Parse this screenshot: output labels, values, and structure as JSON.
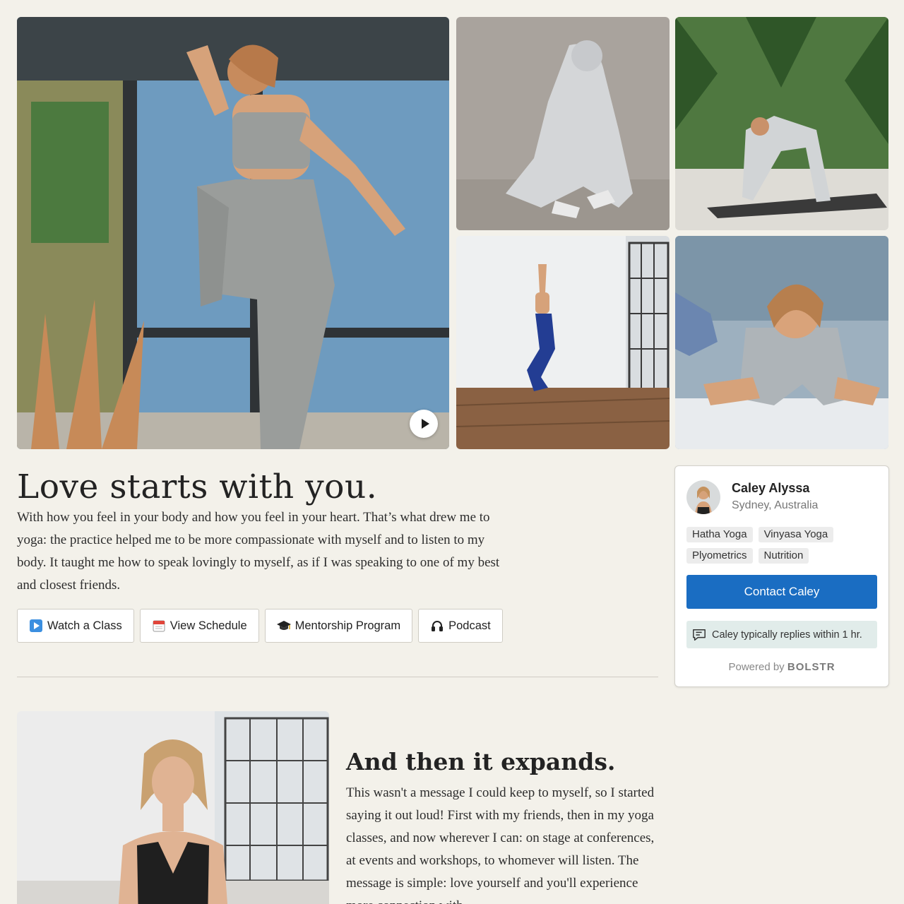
{
  "intro": {
    "headline": "Love starts with you.",
    "body": "With how you feel in your body and how you feel in your heart. That’s what drew me to yoga: the practice helped me to be more compassionate with myself and to listen to my body. It taught me how to speak lovingly to myself, as if I was speaking to one of my best and closest friends."
  },
  "actions": [
    {
      "label": "Watch a Class",
      "icon": "play-emoji-icon"
    },
    {
      "label": "View Schedule",
      "icon": "calendar-emoji-icon"
    },
    {
      "label": "Mentorship Program",
      "icon": "graduation-cap-icon"
    },
    {
      "label": "Podcast",
      "icon": "headphones-icon"
    }
  ],
  "profile": {
    "name": "Caley Alyssa",
    "location": "Sydney, Australia",
    "tags": [
      "Hatha Yoga",
      "Vinyasa Yoga",
      "Plyometrics",
      "Nutrition"
    ],
    "contact_label": "Contact Caley",
    "reply_text": "Caley typically replies within 1 hr.",
    "powered_by": "Powered by",
    "brand": "BOLSTR"
  },
  "section2": {
    "heading": "And then it expands.",
    "body": "This wasn't a message I could keep to myself, so I started saying it out loud! First with my friends, then in my yoga classes, and now wherever I can: on stage at conferences, at events and workshops, to whomever will listen. The message is simple: love yourself and you'll experience more connection with"
  },
  "colors": {
    "background": "#f3f1ea",
    "accent": "#1a6dc2",
    "reply_bg": "#e1ecea"
  }
}
